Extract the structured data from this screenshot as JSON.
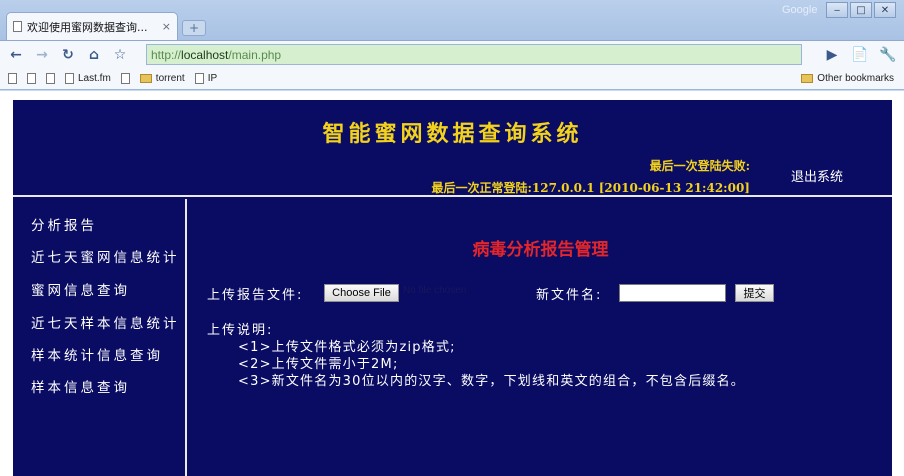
{
  "browser": {
    "tab_title": "欢迎使用蜜网数据查询...",
    "tab_close": "×",
    "new_tab": "+",
    "brand": "Google",
    "window_buttons": [
      "‒",
      "□",
      "✕"
    ],
    "url_prefix": "http://",
    "url_host": "localhost",
    "url_path": "/main.php",
    "bookmarks": [
      "Last.fm",
      "torrent",
      "IP"
    ],
    "other_bookmarks": "Other bookmarks"
  },
  "header": {
    "title": "智能蜜网数据查询系统",
    "last_login_failed": "最后一次登陆失败:",
    "last_login_ok": "最后一次正常登陆:127.0.0.1 [2010-06-13 21:42:00]",
    "logout": "退出系统"
  },
  "sidebar": {
    "items": [
      {
        "label": "分析报告"
      },
      {
        "label": "近七天蜜网信息统计"
      },
      {
        "label": "蜜网信息查询"
      },
      {
        "label": "近七天样本信息统计"
      },
      {
        "label": "样本统计信息查询"
      },
      {
        "label": "样本信息查询"
      }
    ]
  },
  "main": {
    "title": "病毒分析报告管理",
    "upload_label": "上传报告文件:",
    "choose_file": "Choose File",
    "no_file": "No file chosen",
    "new_name_label": "新文件名:",
    "new_name_value": "",
    "submit": "提交",
    "notes_title": "上传说明:",
    "notes": [
      "<1>上传文件格式必须为zip格式;",
      "<2>上传文件需小于2M;",
      "<3>新文件名为30位以内的汉字、数字，下划线和英文的组合，不包含后缀名。"
    ]
  }
}
